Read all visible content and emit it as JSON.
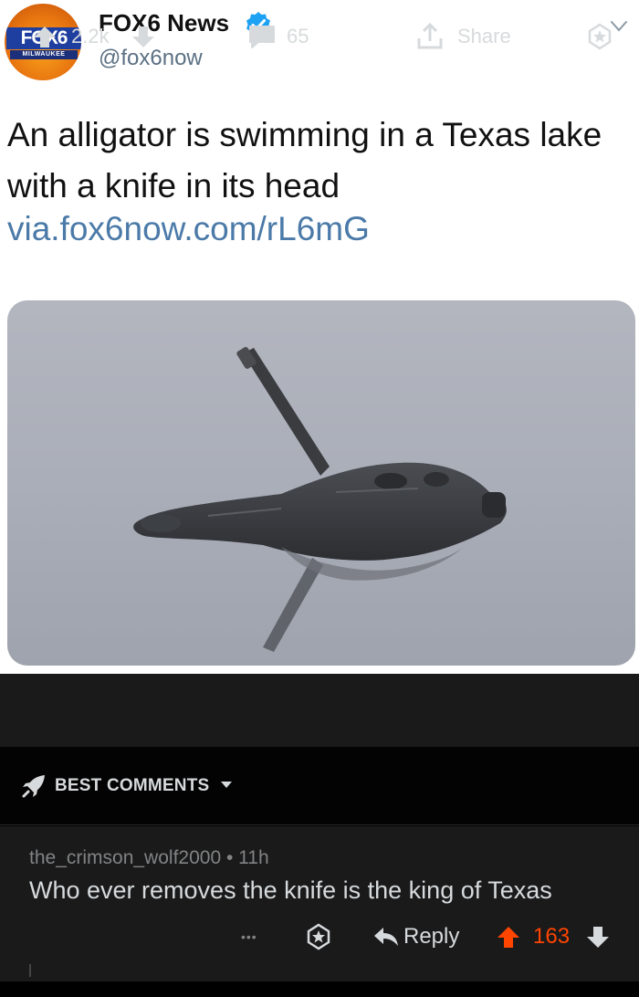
{
  "tweet": {
    "display_name": "FOX6 News",
    "handle": "@fox6now",
    "text": "An alligator is swimming in a Texas lake with a knife in its head",
    "link": "via.fox6now.com/rL6mG",
    "avatar": {
      "logo_text": "FOX6",
      "sub_text": "MILWAUKEE"
    }
  },
  "actions": {
    "upvote_count": "2.2k",
    "comment_count": "65",
    "share_label": "Share"
  },
  "sort": {
    "label": "BEST COMMENTS"
  },
  "comment": {
    "author": "the_crimson_wolf2000",
    "separator": "•",
    "age": "11h",
    "body": "Who ever removes the knife is the king of Texas",
    "more_label": "•••",
    "reply_label": "Reply",
    "score": "163"
  },
  "colors": {
    "link": "#4b7aa8",
    "upvote_active": "#ff4500",
    "verified": "#1da1f2",
    "dark_bg": "#1a1a1b"
  }
}
